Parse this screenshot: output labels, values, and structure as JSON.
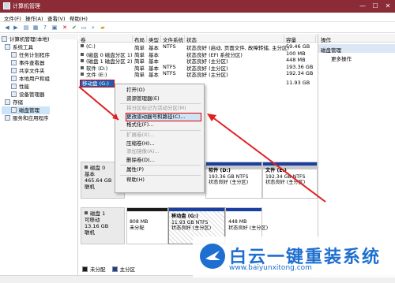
{
  "window": {
    "title": "计算机管理"
  },
  "menu": [
    "文件(F)",
    "操作(A)",
    "查看(V)",
    "帮助(H)"
  ],
  "toolbar_icons": [
    "back-icon",
    "forward-icon",
    "up-icon",
    "list-icon",
    "help-icon",
    "properties-icon",
    "delete-icon",
    "check-icon",
    "open-icon",
    "search-icon",
    "folder-icon"
  ],
  "tree": {
    "items": [
      {
        "label": "计算机管理(本地)",
        "indent": 0
      },
      {
        "label": "系统工具",
        "indent": 1
      },
      {
        "label": "任务计划程序",
        "indent": 2
      },
      {
        "label": "事件查看器",
        "indent": 2
      },
      {
        "label": "共享文件夹",
        "indent": 2
      },
      {
        "label": "本地用户和组",
        "indent": 2
      },
      {
        "label": "性能",
        "indent": 2
      },
      {
        "label": "设备管理器",
        "indent": 2
      },
      {
        "label": "存储",
        "indent": 1
      },
      {
        "label": "磁盘管理",
        "indent": 2,
        "selected": true
      },
      {
        "label": "服务和应用程序",
        "indent": 1
      }
    ]
  },
  "volumes": {
    "headers": [
      "卷",
      "布局",
      "类型",
      "文件系统",
      "状态",
      "容量"
    ],
    "rows": [
      {
        "vol": "(C:)",
        "layout": "简单",
        "type": "基本",
        "fs": "NTFS",
        "status": "状态良好 (启动, 页面文件, 故障转储, 主分区)",
        "cap": "59.46 GB"
      },
      {
        "vol": "(磁盘 0 磁盘分区 1)",
        "layout": "简单",
        "type": "基本",
        "fs": "",
        "status": "状态良好 (EFI 系统分区)",
        "cap": "100 MB"
      },
      {
        "vol": "(磁盘 1 磁盘分区 2)",
        "layout": "简单",
        "type": "基本",
        "fs": "",
        "status": "状态良好 (主分区)",
        "cap": "448 MB"
      },
      {
        "vol": "软件 (D:)",
        "layout": "简单",
        "type": "基本",
        "fs": "NTFS",
        "status": "状态良好 (主分区)",
        "cap": "193.36 GB"
      },
      {
        "vol": "文件 (E:)",
        "layout": "简单",
        "type": "基本",
        "fs": "NTFS",
        "status": "状态良好 (主分区)",
        "cap": "192.34 GB"
      },
      {
        "vol": "",
        "layout": "",
        "type": "",
        "fs": "",
        "status": "",
        "cap": "11.93 GB"
      }
    ],
    "selected_label": "移动盘 (G:)"
  },
  "context_menu": {
    "items": [
      {
        "label": "打开(O)",
        "disabled": false
      },
      {
        "label": "资源管理器(E)",
        "disabled": false
      },
      {
        "sep": true
      },
      {
        "label": "将分区标记为活动分区(M)",
        "disabled": true
      },
      {
        "label": "更改驱动器号和路径(C)...",
        "disabled": false,
        "highlight": true
      },
      {
        "label": "格式化(F)...",
        "disabled": false
      },
      {
        "sep": true
      },
      {
        "label": "扩展卷(X)...",
        "disabled": true
      },
      {
        "label": "压缩卷(H)...",
        "disabled": false
      },
      {
        "label": "添加镜像(A)...",
        "disabled": true
      },
      {
        "label": "删除卷(D)...",
        "disabled": false
      },
      {
        "sep": true
      },
      {
        "label": "属性(P)",
        "disabled": false
      },
      {
        "sep": true
      },
      {
        "label": "帮助(H)",
        "disabled": false
      }
    ]
  },
  "disks": [
    {
      "name": "磁盘 0",
      "type": "基本",
      "size": "465.64 GB",
      "state": "联机"
    },
    {
      "name": "磁盘 1",
      "type": "可移动",
      "size": "13.16 GB",
      "state": "联机"
    }
  ],
  "partitions_disk0": [
    {
      "title": "软件 (D:)",
      "size": "193.36 GB NTFS",
      "status": "状态良好 (主分区)"
    },
    {
      "title": "文件 (E:)",
      "size": "192.34 GB NTFS",
      "status": "状态良好 (主分区)"
    }
  ],
  "partitions_disk1": [
    {
      "title": "",
      "size": "808 MB",
      "status": "未分配"
    },
    {
      "title": "移动盘 (G:)",
      "size": "11.93 GB NTFS",
      "status": "状态良好 (主分区)"
    },
    {
      "title": "",
      "size": "448 MB",
      "status": "状态良好 (主分区)"
    }
  ],
  "legend": [
    {
      "label": "未分配",
      "color": "#1a1a1a"
    },
    {
      "label": "主分区",
      "color": "#1a3fa0"
    }
  ],
  "actions": {
    "header": "操作",
    "section": "磁盘管理",
    "more": "更多操作"
  },
  "watermark": {
    "text": "白云一键重装系统",
    "url": "www.baiyunxitong.com"
  },
  "colors": {
    "titlebar": "#8a2b35",
    "primary_partition": "#1a3fa0",
    "unallocated": "#1a1a1a",
    "highlight": "#dd0000",
    "watermark": "#1e6fcf"
  }
}
